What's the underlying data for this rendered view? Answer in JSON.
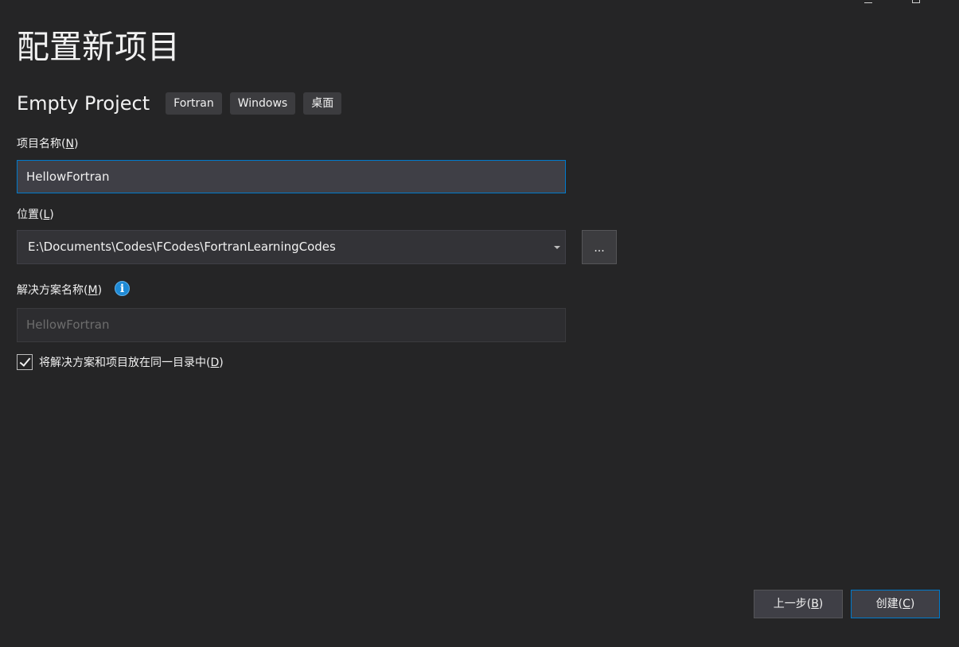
{
  "page": {
    "title": "配置新项目"
  },
  "template": {
    "name": "Empty Project",
    "tags": [
      "Fortran",
      "Windows",
      "桌面"
    ]
  },
  "project_name": {
    "label": "项目名称(",
    "accel": "N",
    "label_end": ")",
    "value": "HellowFortran"
  },
  "location": {
    "label": "位置(",
    "accel": "L",
    "label_end": ")",
    "value": "E:\\Documents\\Codes\\FCodes\\FortranLearningCodes",
    "browse_label": "..."
  },
  "solution_name": {
    "label": "解决方案名称(",
    "accel": "M",
    "label_end": ")",
    "info_icon": "i",
    "value": "HellowFortran"
  },
  "same_dir": {
    "checked": true,
    "label": "将解决方案和项目放在同一目录中(",
    "accel": "D",
    "label_end": ")"
  },
  "footer": {
    "back_label": "上一步(",
    "back_accel": "B",
    "back_end": ")",
    "create_label": "创建(",
    "create_accel": "C",
    "create_end": ")"
  },
  "colors": {
    "background": "#252526",
    "accent": "#007acc",
    "info": "#1e8ad6"
  }
}
